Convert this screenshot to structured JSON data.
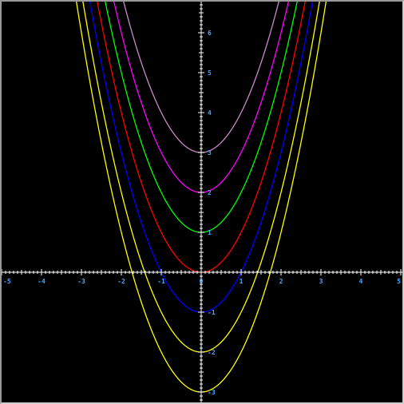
{
  "chart_data": {
    "type": "line",
    "title": "",
    "xlabel": "",
    "ylabel": "",
    "xlim": [
      -5,
      5
    ],
    "ylim": [
      -3,
      6.8
    ],
    "grid": false,
    "legend": "none",
    "x_ticks": [
      "-5",
      "-4",
      "-3",
      "-2",
      "-1",
      "0",
      "1",
      "2",
      "3",
      "4",
      "5"
    ],
    "y_ticks": [
      "-3",
      "-2",
      "-1",
      "1",
      "2",
      "3",
      "4",
      "5",
      "6"
    ],
    "axis_color": "#ffffff",
    "tick_label_color": "#3fa8ff",
    "background": "#000000",
    "series": [
      {
        "formula": "y = x^2 - 3",
        "shift": -3,
        "color": "#ffff00"
      },
      {
        "formula": "y = x^2 - 2",
        "shift": -2,
        "color": "#ffff00"
      },
      {
        "formula": "y = x^2 - 1",
        "shift": -1,
        "color": "#0000ff"
      },
      {
        "formula": "y = x^2",
        "shift": 0,
        "color": "#ff0000"
      },
      {
        "formula": "y = x^2 + 1",
        "shift": 1,
        "color": "#00ff00"
      },
      {
        "formula": "y = x^2 + 2",
        "shift": 2,
        "color": "#ff00ff"
      },
      {
        "formula": "y = x^2 + 3",
        "shift": 3,
        "color": "#cc88cc"
      }
    ]
  }
}
